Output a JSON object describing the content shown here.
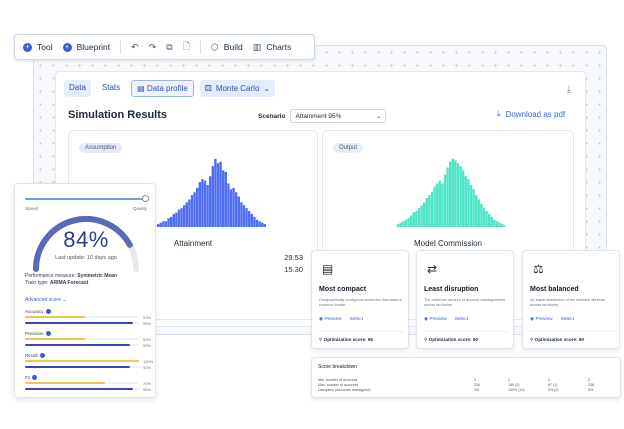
{
  "toolbar": {
    "tool": "Tool",
    "blueprint": "Blueprint",
    "build": "Build",
    "charts": "Charts"
  },
  "tabs": [
    "Data",
    "Stats",
    "Data profile",
    "Monte Carlo"
  ],
  "sim": {
    "title": "Simulation Results",
    "scenario_label": "Scenario",
    "scenario_value": "Attainment 95%",
    "download": "Download as pdf"
  },
  "cards": {
    "assumption": {
      "badge": "Assumption",
      "label": "Attainment",
      "color": "#4f6ff0",
      "stat1": "29.53",
      "stat2": "15.30"
    },
    "output": {
      "badge": "Output",
      "label": "Model Commission",
      "color": "#4fe3c8"
    }
  },
  "histograms": {
    "attainment": [
      2,
      3,
      4,
      4,
      6,
      7,
      9,
      10,
      12,
      13,
      15,
      17,
      19,
      22,
      24,
      27,
      31,
      33,
      32,
      29,
      35,
      42,
      47,
      44,
      45,
      39,
      38,
      30,
      26,
      27,
      24,
      21,
      17,
      15,
      13,
      11,
      9,
      7,
      5,
      4,
      3,
      2
    ],
    "commission": [
      2,
      3,
      4,
      5,
      6,
      8,
      10,
      11,
      13,
      15,
      17,
      20,
      22,
      24,
      28,
      30,
      32,
      30,
      36,
      41,
      45,
      47,
      46,
      44,
      42,
      39,
      35,
      33,
      29,
      26,
      22,
      19,
      16,
      13,
      11,
      9,
      7,
      5,
      4,
      3,
      2,
      1
    ]
  },
  "perf": {
    "speed_label": "Speed",
    "quality_label": "Quality",
    "speed_level": 1.0,
    "gauge_fraction": 0.84,
    "value": "84%",
    "last_update": "Last update: 10 days ago",
    "measure_label": "Performance measure: ",
    "measure_value": "Symmetric Mean",
    "train_label": "Train type: ",
    "train_value": "ARIMA Forecast",
    "advanced": "Advanced score",
    "metrics": [
      {
        "name": "Accuracy",
        "yellow": 0.53,
        "blue": 0.95,
        "yellow_pct": "53%",
        "blue_pct": "95%"
      },
      {
        "name": "Precision",
        "yellow": 0.53,
        "blue": 0.92,
        "yellow_pct": "53%",
        "blue_pct": "92%"
      },
      {
        "name": "Recall",
        "yellow": 1.0,
        "blue": 0.92,
        "yellow_pct": "100%",
        "blue_pct": "92%"
      },
      {
        "name": "F1",
        "yellow": 0.7,
        "blue": 0.95,
        "yellow_pct": "70%",
        "blue_pct": "95%"
      }
    ]
  },
  "options": [
    {
      "icon": "book-map-icon",
      "title": "Most compact",
      "desc": "Geographically contiguous territories that share a common border",
      "preview": "Preview",
      "select": "Select",
      "score": "Optimization score: 95"
    },
    {
      "icon": "swap-arrows-icon",
      "title": "Least disruption",
      "desc": "The minimum amount of account reassignments across territories",
      "preview": "Preview",
      "select": "Select",
      "score": "Optimization score: 90"
    },
    {
      "icon": "scales-icon",
      "title": "Most balanced",
      "desc": "An equal distribution of the selected attribute across territories",
      "preview": "Preview",
      "select": "Select",
      "score": "Optimization score: 90"
    }
  ],
  "score_breakdown": {
    "title": "Score breakdown",
    "rows": [
      "Min. number of accounts",
      "Max. number of accounts",
      "Disruption (accounts reassigned)"
    ],
    "cols": [
      [
        "3",
        "234",
        "3%"
      ],
      [
        "2",
        "180 (2)",
        "100% (14)"
      ],
      [
        "2",
        "87 (1)",
        "5% (2)"
      ],
      [
        "3",
        "236",
        "3%"
      ]
    ]
  }
}
